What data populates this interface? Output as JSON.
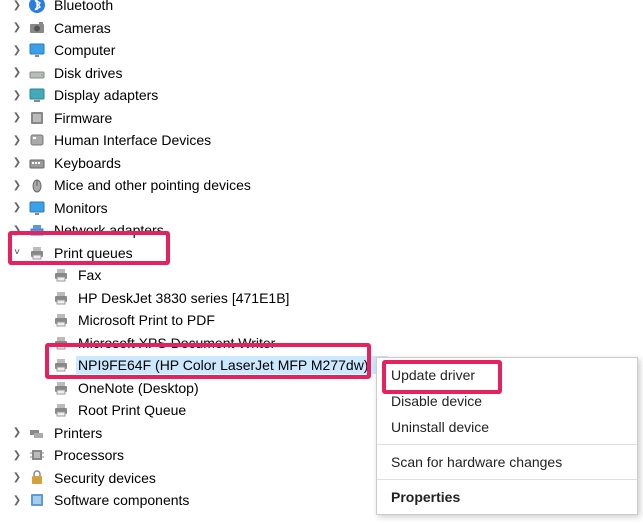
{
  "tree": {
    "nodes": [
      {
        "id": "bluetooth",
        "label": "Bluetooth",
        "icon": "bluetooth",
        "expanded": false
      },
      {
        "id": "cameras",
        "label": "Cameras",
        "icon": "camera",
        "expanded": false
      },
      {
        "id": "computer",
        "label": "Computer",
        "icon": "monitor",
        "expanded": false
      },
      {
        "id": "disk-drives",
        "label": "Disk drives",
        "icon": "disk",
        "expanded": false
      },
      {
        "id": "display-adapters",
        "label": "Display adapters",
        "icon": "display",
        "expanded": false
      },
      {
        "id": "firmware",
        "label": "Firmware",
        "icon": "firmware",
        "expanded": false
      },
      {
        "id": "hid",
        "label": "Human Interface Devices",
        "icon": "hid",
        "expanded": false
      },
      {
        "id": "keyboards",
        "label": "Keyboards",
        "icon": "keyboard",
        "expanded": false
      },
      {
        "id": "mice",
        "label": "Mice and other pointing devices",
        "icon": "mouse",
        "expanded": false
      },
      {
        "id": "monitors",
        "label": "Monitors",
        "icon": "monitor",
        "expanded": false
      },
      {
        "id": "network",
        "label": "Network adapters",
        "icon": "network",
        "expanded": false
      },
      {
        "id": "print-queues",
        "label": "Print queues",
        "icon": "printer",
        "expanded": true,
        "children": [
          {
            "id": "fax",
            "label": "Fax",
            "icon": "printer"
          },
          {
            "id": "hp3830",
            "label": "HP DeskJet 3830 series [471E1B]",
            "icon": "printer"
          },
          {
            "id": "ms-pdf",
            "label": "Microsoft Print to PDF",
            "icon": "printer"
          },
          {
            "id": "ms-xps",
            "label": "Microsoft XPS Document Writer",
            "icon": "printer",
            "truncated_label": "Microsoft XPS Document Wri"
          },
          {
            "id": "npi",
            "label": "NPI9FE64F (HP Color LaserJet MFP M277dw)",
            "icon": "printer",
            "selected": true,
            "truncated_label": "NPI9FE64F (HP Color LaserJet MFP M277d"
          },
          {
            "id": "onenote",
            "label": "OneNote (Desktop)",
            "icon": "printer"
          },
          {
            "id": "rootpq",
            "label": "Root Print Queue",
            "icon": "printer"
          }
        ]
      },
      {
        "id": "printers",
        "label": "Printers",
        "icon": "printers",
        "expanded": false
      },
      {
        "id": "processors",
        "label": "Processors",
        "icon": "cpu",
        "expanded": false
      },
      {
        "id": "security",
        "label": "Security devices",
        "icon": "security",
        "expanded": false
      },
      {
        "id": "software-components",
        "label": "Software components",
        "icon": "software",
        "expanded": false
      }
    ]
  },
  "context_menu": {
    "items": [
      {
        "id": "update-driver",
        "label": "Update driver"
      },
      {
        "id": "disable-device",
        "label": "Disable device"
      },
      {
        "id": "uninstall-device",
        "label": "Uninstall device"
      },
      {
        "id": "sep",
        "type": "separator"
      },
      {
        "id": "scan-hardware",
        "label": "Scan for hardware changes"
      },
      {
        "id": "sep2",
        "type": "separator"
      },
      {
        "id": "properties",
        "label": "Properties",
        "bold": true
      }
    ]
  }
}
